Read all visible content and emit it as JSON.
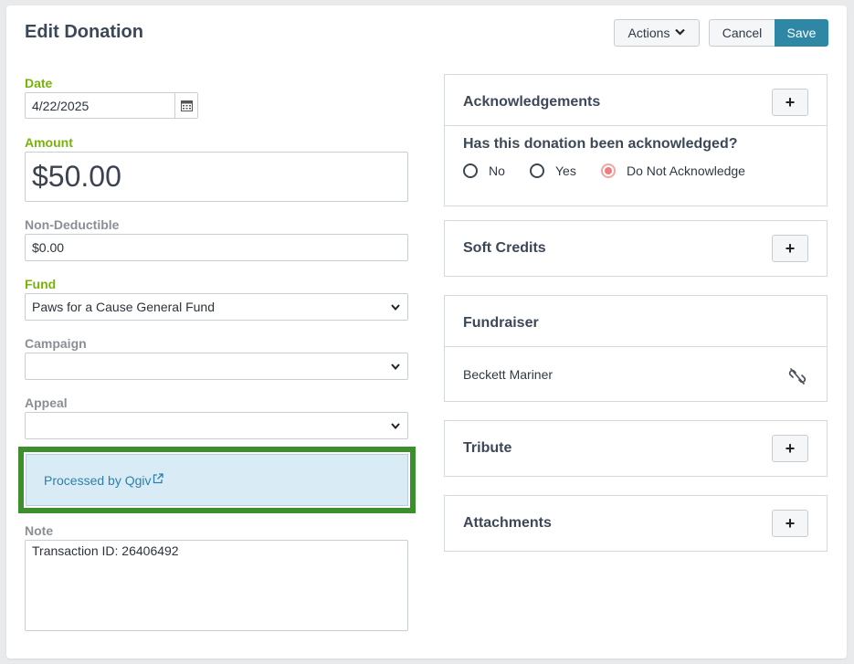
{
  "header": {
    "title": "Edit Donation",
    "actions_label": "Actions",
    "cancel_label": "Cancel",
    "save_label": "Save"
  },
  "form": {
    "date_label": "Date",
    "date_value": "4/22/2025",
    "amount_label": "Amount",
    "amount_value": "$50.00",
    "non_deductible_label": "Non-Deductible",
    "non_deductible_value": "$0.00",
    "fund_label": "Fund",
    "fund_value": "Paws for a Cause General Fund",
    "campaign_label": "Campaign",
    "campaign_value": "",
    "appeal_label": "Appeal",
    "appeal_value": "",
    "processed_text": "Processed by Qgiv",
    "note_label": "Note",
    "note_value": "Transaction ID: 26406492"
  },
  "acknowledgements": {
    "title": "Acknowledgements",
    "question": "Has this donation been acknowledged?",
    "options": [
      "No",
      "Yes",
      "Do Not Acknowledge"
    ],
    "selected": "Do Not Acknowledge"
  },
  "soft_credits": {
    "title": "Soft Credits"
  },
  "fundraiser": {
    "title": "Fundraiser",
    "name": "Beckett Mariner"
  },
  "tribute": {
    "title": "Tribute"
  },
  "attachments": {
    "title": "Attachments"
  },
  "colors": {
    "accent_green": "#78b30a",
    "save_blue": "#2f87a6",
    "highlight_border": "#3d8f2d",
    "processed_bg": "#d9ecf6",
    "radio_selected": "#f27c7c"
  },
  "icons": {
    "date": "calendar-icon",
    "actions": "chevron-down-icon",
    "add": "plus-icon",
    "processed": "external-link-icon",
    "fundraiser": "unlink-icon"
  }
}
